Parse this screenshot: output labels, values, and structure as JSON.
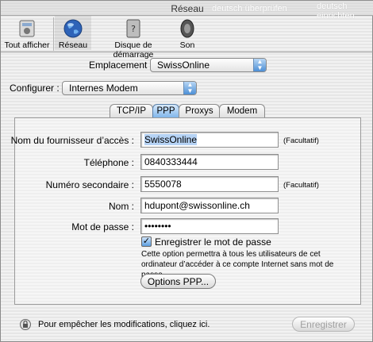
{
  "window": {
    "title": "Réseau",
    "ghost_text_1": "deutsch überprüfen",
    "ghost_text_2": "deutsch einrichten"
  },
  "toolbar": {
    "items": [
      {
        "label": "Tout afficher",
        "icon": "apple-panel-icon"
      },
      {
        "label": "Réseau",
        "icon": "globe-icon",
        "selected": true
      },
      {
        "label": "Disque de démarrage",
        "icon": "startup-disk-icon"
      },
      {
        "label": "Son",
        "icon": "speaker-icon"
      }
    ]
  },
  "location": {
    "label": "Emplacement :",
    "value": "SwissOnline"
  },
  "configure": {
    "label": "Configurer :",
    "value": "Internes Modem"
  },
  "tabs": [
    {
      "label": "TCP/IP"
    },
    {
      "label": "PPP",
      "active": true
    },
    {
      "label": "Proxys"
    },
    {
      "label": "Modem"
    }
  ],
  "form": {
    "provider": {
      "label": "Nom du fournisseur d’accès :",
      "value": "SwissOnline",
      "hint": "(Facultatif)"
    },
    "phone": {
      "label": "Téléphone :",
      "value": "0840333444"
    },
    "alt_phone": {
      "label": "Numéro secondaire :",
      "value": "5550078",
      "hint": "(Facultatif)"
    },
    "name": {
      "label": "Nom :",
      "value": "hdupont@swissonline.ch"
    },
    "password": {
      "label": "Mot de passe :",
      "value": "••••••••"
    },
    "save_password": {
      "label": "Enregistrer le mot de passe",
      "checked": true
    },
    "save_password_note": "Cette option permettra à tous les utilisateurs de cet ordinateur d’accéder à ce compte Internet sans mot de passe.",
    "ppp_options_button": "Options PPP..."
  },
  "footer": {
    "lock_text": "Pour empêcher les modifications, cliquez ici.",
    "save_button": "Enregistrer"
  },
  "colors": {
    "accent": "#4c8fd6",
    "selection": "#b6d3f5"
  }
}
